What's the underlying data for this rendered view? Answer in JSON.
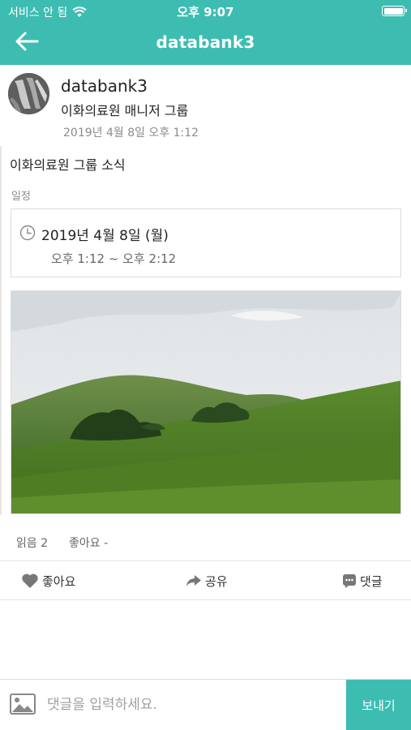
{
  "status_bar": {
    "carrier": "서비스 안 됨",
    "time": "오후 9:07"
  },
  "nav": {
    "title": "databank3",
    "back_icon": "arrow-left-icon"
  },
  "author": {
    "name": "databank3",
    "group": "이화의료원 매니저 그룹",
    "posted_at": "2019년 4월 8일 오후 1:12"
  },
  "post": {
    "title": "이화의료원 그룹 소식",
    "schedule_label": "일정",
    "schedule": {
      "date": "2019년 4월 8일 (월)",
      "time_range": "오후 1:12 ~ 오후 2:12",
      "icon": "clock-icon"
    }
  },
  "stats": {
    "reads": "읽음 2",
    "likes": "좋아요 -"
  },
  "actions": {
    "like_label": "좋아요",
    "share_label": "공유",
    "comment_label": "댓글"
  },
  "comment_bar": {
    "placeholder": "댓글을 입력하세요.",
    "send_label": "보내기"
  },
  "colors": {
    "accent": "#3dbdb2",
    "muted_text": "#8c8c8c",
    "border": "#dcdcdc"
  }
}
